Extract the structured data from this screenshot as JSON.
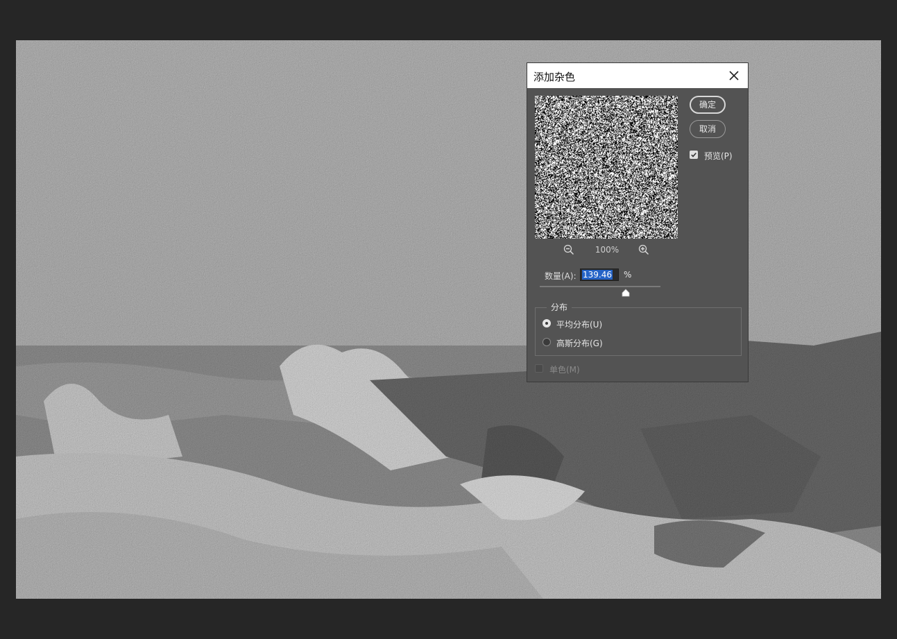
{
  "dialog": {
    "title": "添加杂色",
    "ok_label": "确定",
    "cancel_label": "取消",
    "preview_label": "预览(P)",
    "preview_checked": true,
    "zoom_level": "100%",
    "amount_label": "数量(A):",
    "amount_value": "139.46",
    "amount_unit": "%",
    "distribution_title": "分布",
    "distribution_options": [
      "平均分布(U)",
      "高斯分布(G)"
    ],
    "distribution_selected": "平均分布(U)",
    "monochromatic_label": "单色(M)",
    "monochromatic_checked": false
  },
  "icons": {
    "close": "close-icon",
    "zoom_out": "zoom-out-icon",
    "zoom_in": "zoom-in-icon",
    "checkmark": "checkmark-icon",
    "slider_thumb": "slider-thumb-icon"
  },
  "colors": {
    "app_background": "#262626",
    "dialog_background": "#535353",
    "title_bar": "#ffffff",
    "input_selection": "#2463c7"
  }
}
